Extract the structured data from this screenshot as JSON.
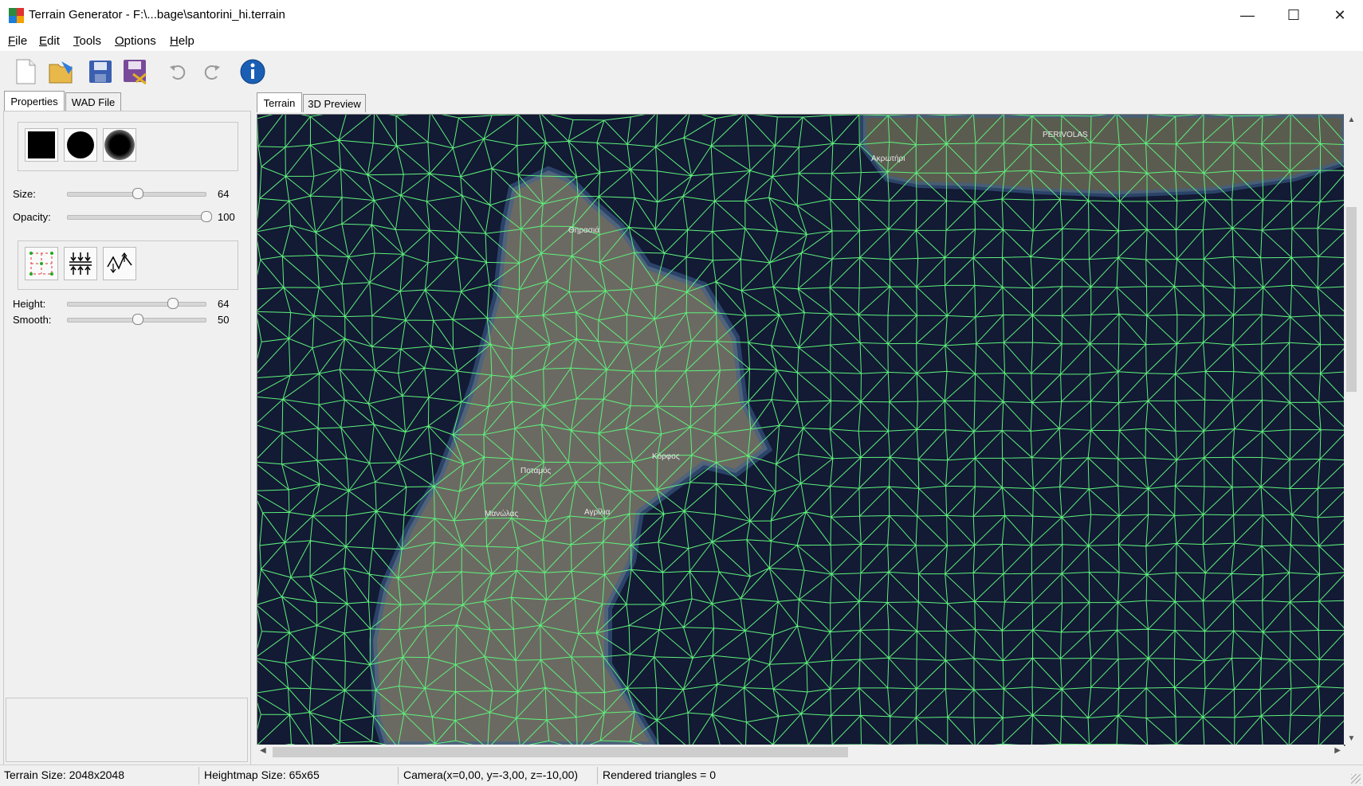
{
  "window": {
    "title": "Terrain Generator - F:\\...bage\\santorini_hi.terrain",
    "minimize_glyph": "—",
    "maximize_glyph": "☐",
    "close_glyph": "✕"
  },
  "menu": [
    {
      "label": "File",
      "mnemonic": "F",
      "rest": "ile"
    },
    {
      "label": "Edit",
      "mnemonic": "E",
      "rest": "dit"
    },
    {
      "label": "Tools",
      "mnemonic": "T",
      "rest": "ools"
    },
    {
      "label": "Options",
      "mnemonic": "O",
      "rest": "ptions"
    },
    {
      "label": "Help",
      "mnemonic": "H",
      "rest": "elp"
    }
  ],
  "toolbar": {
    "icons": [
      "new-file-icon",
      "open-folder-icon",
      "save-icon",
      "save-as-icon",
      "undo-icon",
      "redo-icon",
      "info-icon"
    ]
  },
  "left_tabs": [
    "Properties",
    "WAD File"
  ],
  "view_tabs": [
    "Terrain",
    "3D Preview"
  ],
  "brush": {
    "shapes": [
      "square-brush-icon",
      "circle-brush-icon",
      "soft-circle-brush-icon"
    ],
    "size_label": "Size:",
    "size_value": "64",
    "size_fraction": 0.5,
    "opacity_label": "Opacity:",
    "opacity_value": "100",
    "opacity_fraction": 1.0
  },
  "tools": {
    "icons": [
      "grid-points-tool-icon",
      "raise-lower-tool-icon",
      "smooth-tool-icon"
    ],
    "height_label": "Height:",
    "height_value": "64",
    "height_fraction": 0.76,
    "smooth_label": "Smooth:",
    "smooth_value": "50",
    "smooth_fraction": 0.5
  },
  "map_labels": [
    "PERIVOLAS",
    "Ακρωτήρι",
    "Θηρασιά",
    "Κόρφος",
    "Ποταμός",
    "Μανώλας",
    "Αγρίλια"
  ],
  "status": {
    "terrain_size": "Terrain Size: 2048x2048",
    "heightmap_size": "Heightmap Size: 65x65",
    "camera": "Camera(x=0,00, y=-3,00, z=-10,00)",
    "triangles": "Rendered triangles = 0"
  },
  "colors": {
    "mesh": "#5ef07a",
    "sea": "#121a34",
    "land": "#6b6a62",
    "info_blue": "#1a5fb4"
  },
  "scroll": {
    "vertical_position": 0.2,
    "horizontal_position": 0.0
  }
}
